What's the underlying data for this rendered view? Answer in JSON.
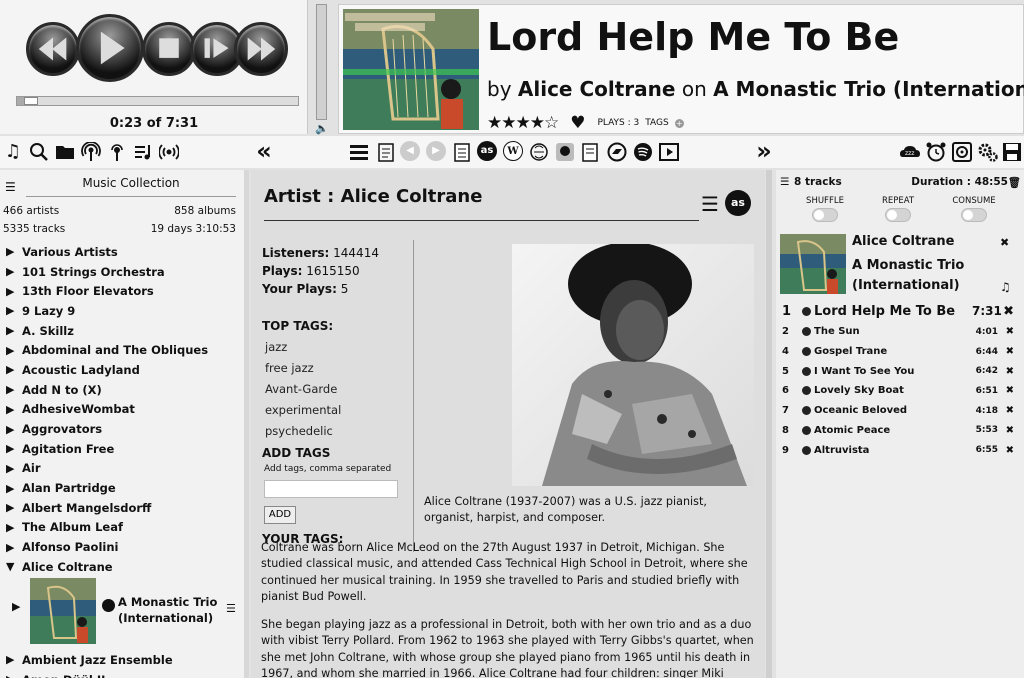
{
  "player": {
    "time_display": "0:23 of 7:31",
    "progress_fraction": 0.05,
    "buttons": [
      "previous-icon",
      "play-icon",
      "stop-icon",
      "pause-play-icon",
      "next-icon"
    ]
  },
  "now_playing": {
    "title": "Lord Help Me To Be",
    "by_word": "by",
    "artist": "Alice Coltrane",
    "on_word": "on",
    "album": "A Monastic Trio (International)",
    "rating_stars": 4,
    "stars_text": "★★★★☆",
    "plays_label": "PLAYS : 3",
    "tags_label": "TAGS",
    "tags_plus": "+"
  },
  "toolbar": {
    "lastfm_badge": "as",
    "wiki_badge": "W",
    "prev_arrows": "«",
    "next_arrows": "»"
  },
  "collection": {
    "title": "Music Collection",
    "artists_count": "466 artists",
    "albums_count": "858 albums",
    "tracks_count": "5335 tracks",
    "duration": "19 days 3:10:53",
    "artists": [
      "Various Artists",
      "101 Strings Orchestra",
      "13th Floor Elevators",
      "9 Lazy 9",
      "A. Skillz",
      "Abdominal and The Obliques",
      "Acoustic Ladyland",
      "Add N to (X)",
      "AdhesiveWombat",
      "Aggrovators",
      "Agitation Free",
      "Air",
      "Alan Partridge",
      "Albert Mangelsdorff",
      "The Album Leaf",
      "Alfonso Paolini",
      "Alice Coltrane"
    ],
    "expanded_album": "A Monastic Trio (International)",
    "after_artists": [
      "Ambient Jazz Ensemble",
      "Amon Düül II"
    ]
  },
  "artist_panel": {
    "title": "Artist : Alice Coltrane",
    "listeners_label": "Listeners:",
    "listeners_value": "144414",
    "plays_label": "Plays:",
    "plays_value": "1615150",
    "your_plays_label": "Your Plays:",
    "your_plays_value": "5",
    "top_tags_heading": "TOP TAGS:",
    "top_tags": [
      "jazz",
      "free jazz",
      "Avant-Garde",
      "experimental",
      "psychedelic"
    ],
    "add_tags_heading": "ADD TAGS",
    "add_tags_hint": "Add tags, comma separated",
    "add_button": "ADD",
    "your_tags_heading": "YOUR TAGS:",
    "bio": [
      "Alice Coltrane (1937-2007) was a U.S. jazz pianist, organist, harpist, and composer.",
      "Coltrane was born Alice McLeod on the 27th August 1937 in Detroit, Michigan. She studied classical music, and attended Cass Technical High School in Detroit, where she continued her musical training. In 1959 she travelled to Paris and studied briefly with pianist Bud Powell.",
      "She began playing jazz as a professional in Detroit, both with her own trio and as a duo with vibist Terry Pollard. From 1962 to 1963 she played with Terry Gibbs's quartet, when she met John Coltrane, with whose group she played piano from 1965 until his death in 1967, and whom she married in 1966. Alice Coltrane had four children: singer Miki (Michele) from a"
    ]
  },
  "playlist": {
    "track_count": "8 tracks",
    "duration": "Duration : 48:55",
    "shuffle_label": "SHUFFLE",
    "repeat_label": "REPEAT",
    "consume_label": "CONSUME",
    "artist": "Alice Coltrane",
    "album": "A Monastic Trio (International)",
    "tracks": [
      {
        "num": "1",
        "title": "Lord Help Me To Be",
        "duration": "7:31"
      },
      {
        "num": "2",
        "title": "The Sun",
        "duration": "4:01"
      },
      {
        "num": "4",
        "title": "Gospel Trane",
        "duration": "6:44"
      },
      {
        "num": "5",
        "title": "I Want To See You",
        "duration": "6:42"
      },
      {
        "num": "6",
        "title": "Lovely Sky Boat",
        "duration": "6:51"
      },
      {
        "num": "7",
        "title": "Oceanic Beloved",
        "duration": "4:18"
      },
      {
        "num": "8",
        "title": "Atomic Peace",
        "duration": "5:53"
      },
      {
        "num": "9",
        "title": "Altruvista",
        "duration": "6:55"
      }
    ]
  },
  "colors": {
    "background": "#e2e2e2",
    "panel": "#f4f4f4",
    "text": "#111111"
  }
}
